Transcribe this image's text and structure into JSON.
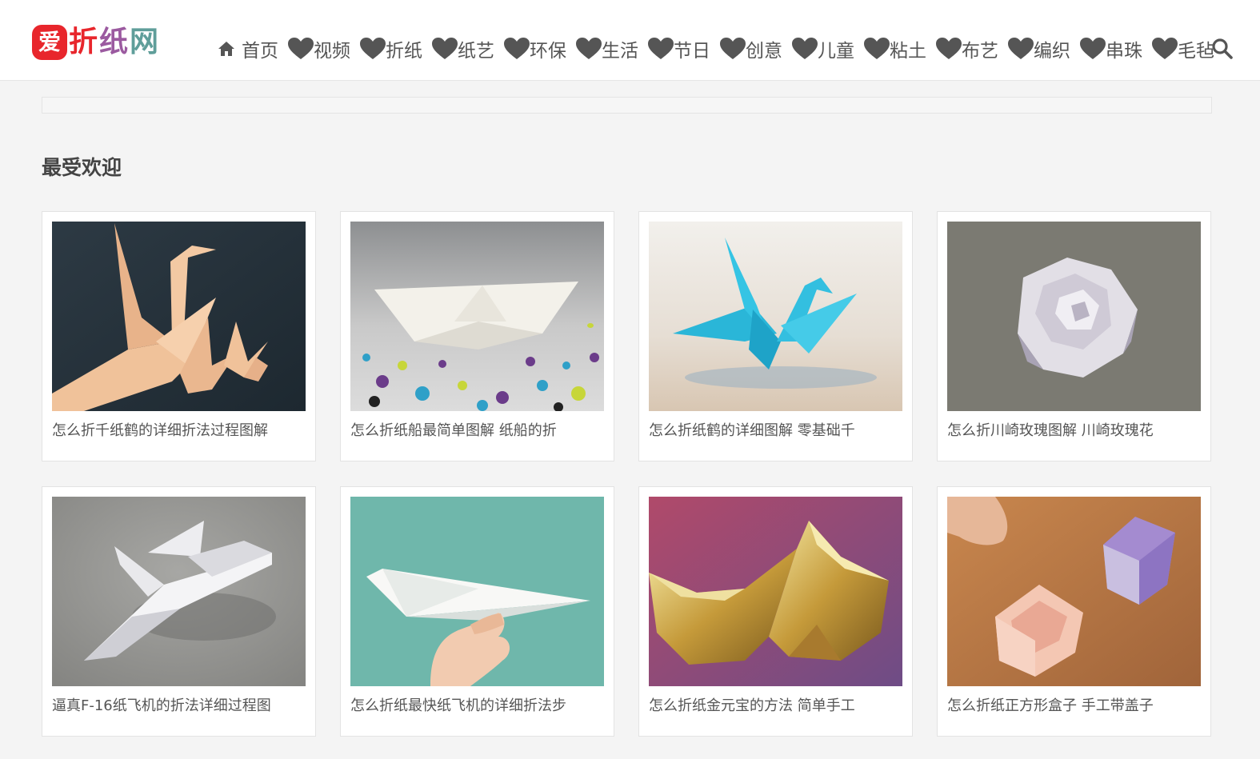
{
  "header": {
    "logo": {
      "mark": "爱",
      "text1": "折",
      "text2": "纸",
      "text3": "网",
      "brand_colors": [
        "#e8262c",
        "#9b5aa0",
        "#5f9e9a"
      ]
    },
    "nav": [
      {
        "label": "首页",
        "icon": "home-icon"
      },
      {
        "label": "视频",
        "icon": "heart-icon"
      },
      {
        "label": "折纸",
        "icon": "heart-icon"
      },
      {
        "label": "纸艺",
        "icon": "heart-icon"
      },
      {
        "label": "环保",
        "icon": "heart-icon"
      },
      {
        "label": "生活",
        "icon": "heart-icon"
      },
      {
        "label": "节日",
        "icon": "heart-icon"
      },
      {
        "label": "创意",
        "icon": "heart-icon"
      },
      {
        "label": "儿童",
        "icon": "heart-icon"
      },
      {
        "label": "粘土",
        "icon": "heart-icon"
      },
      {
        "label": "布艺",
        "icon": "heart-icon"
      },
      {
        "label": "编织",
        "icon": "heart-icon"
      },
      {
        "label": "串珠",
        "icon": "heart-icon"
      },
      {
        "label": "毛毡",
        "icon": "heart-icon"
      }
    ],
    "search_icon": "search-icon"
  },
  "main": {
    "section_title": "最受欢迎",
    "cards": [
      {
        "title": "怎么折千纸鹤的详细折法过程图解",
        "image": "origami-cranes-peach"
      },
      {
        "title": "怎么折纸船最简单图解 纸船的折",
        "image": "origami-paper-boat"
      },
      {
        "title": "怎么折纸鹤的详细图解 零基础千",
        "image": "origami-blue-crane"
      },
      {
        "title": "怎么折川崎玫瑰图解 川崎玫瑰花",
        "image": "origami-kawasaki-rose"
      },
      {
        "title": "逼真F-16纸飞机的折法详细过程图",
        "image": "origami-f16-jet"
      },
      {
        "title": "怎么折纸最快纸飞机的详细折法步",
        "image": "paper-airplane-in-hand"
      },
      {
        "title": "怎么折纸金元宝的方法 简单手工",
        "image": "origami-gold-ingots"
      },
      {
        "title": "怎么折纸正方形盒子 手工带盖子",
        "image": "origami-square-boxes"
      }
    ]
  }
}
